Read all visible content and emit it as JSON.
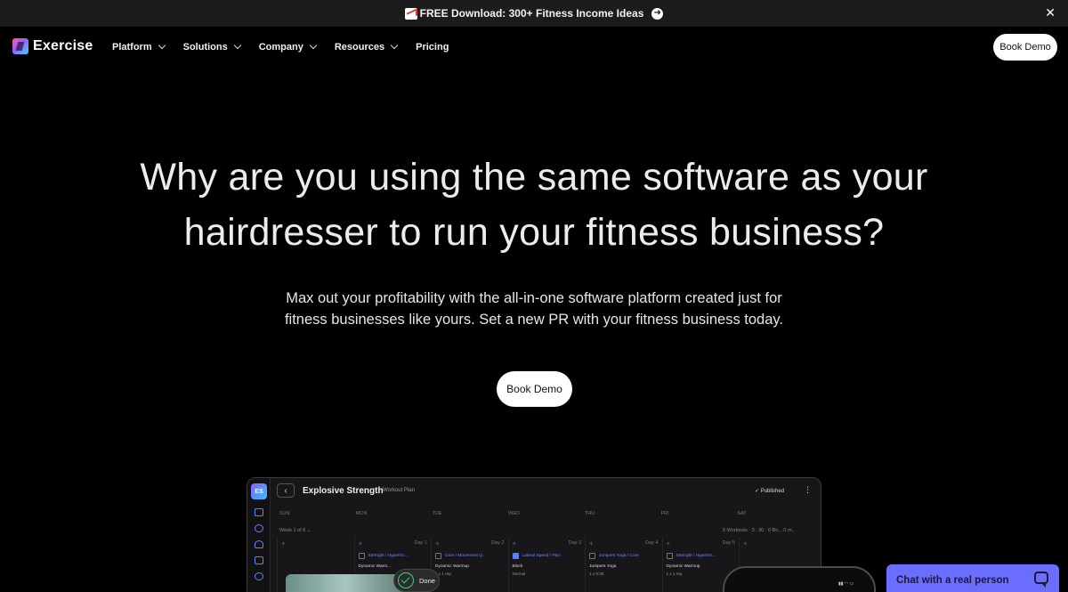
{
  "announcement": {
    "text": "FREE Download: 300+ Fitness Income Ideas",
    "icon": "chart-emoji-icon",
    "arrow": "➜",
    "close": "✕"
  },
  "nav": {
    "brand": "Exercise",
    "items": [
      {
        "label": "Platform",
        "has_dropdown": true
      },
      {
        "label": "Solutions",
        "has_dropdown": true
      },
      {
        "label": "Company",
        "has_dropdown": true
      },
      {
        "label": "Resources",
        "has_dropdown": true
      },
      {
        "label": "Pricing",
        "has_dropdown": false
      }
    ],
    "cta": "Book Demo"
  },
  "hero": {
    "title_line1": "Why are you using the same software as your",
    "title_line2": "hairdresser to run your fitness business?",
    "sub_line1": "Max out your profitability with the all-in-one software platform created just for",
    "sub_line2": "fitness businesses like yours. Set a new PR with your fitness business today.",
    "cta": "Book Demo"
  },
  "preview": {
    "avatar": "ES",
    "back": "‹",
    "title": "Explosive Strength",
    "tag": "Workout Plan",
    "status": "✓ Published",
    "menu": "⋮",
    "days": [
      "SUN",
      "MON",
      "TUE",
      "WED",
      "THU",
      "FRI",
      "SAT"
    ],
    "week": "Week 1 of 6 ⌄",
    "workouts": "5 Workouts · 3 : 30 : 0 Bo... 0 m..",
    "columns": [
      {
        "day": "",
        "card": "",
        "checked": false,
        "line1": "",
        "line2": ""
      },
      {
        "day": "Day 1",
        "card": "Strength / Hypertro...",
        "checked": false,
        "line1": "Dynamic Warm...",
        "line2": ""
      },
      {
        "day": "Day 2",
        "card": "Core / Movement Q...",
        "checked": false,
        "line1": "Dynamic Warmup",
        "line2": "1 x 1 rep"
      },
      {
        "day": "Day 3",
        "card": "Lateral Speed / Plyo",
        "checked": true,
        "line1": "Block",
        "line2": "Normal"
      },
      {
        "day": "Day 4",
        "card": "Jumpers Yoga / Core",
        "checked": false,
        "line1": "Jumpers Yoga",
        "line2": "1 x 0:30"
      },
      {
        "day": "Day 5",
        "card": "Strength / Hypertro...",
        "checked": false,
        "line1": "Dynamic Warmup",
        "line2": "1 x 1 rep"
      },
      {
        "day": "",
        "card": "",
        "checked": false,
        "line1": "",
        "line2": ""
      }
    ],
    "done": "Done"
  },
  "chat": {
    "label": "Chat with a real person"
  }
}
